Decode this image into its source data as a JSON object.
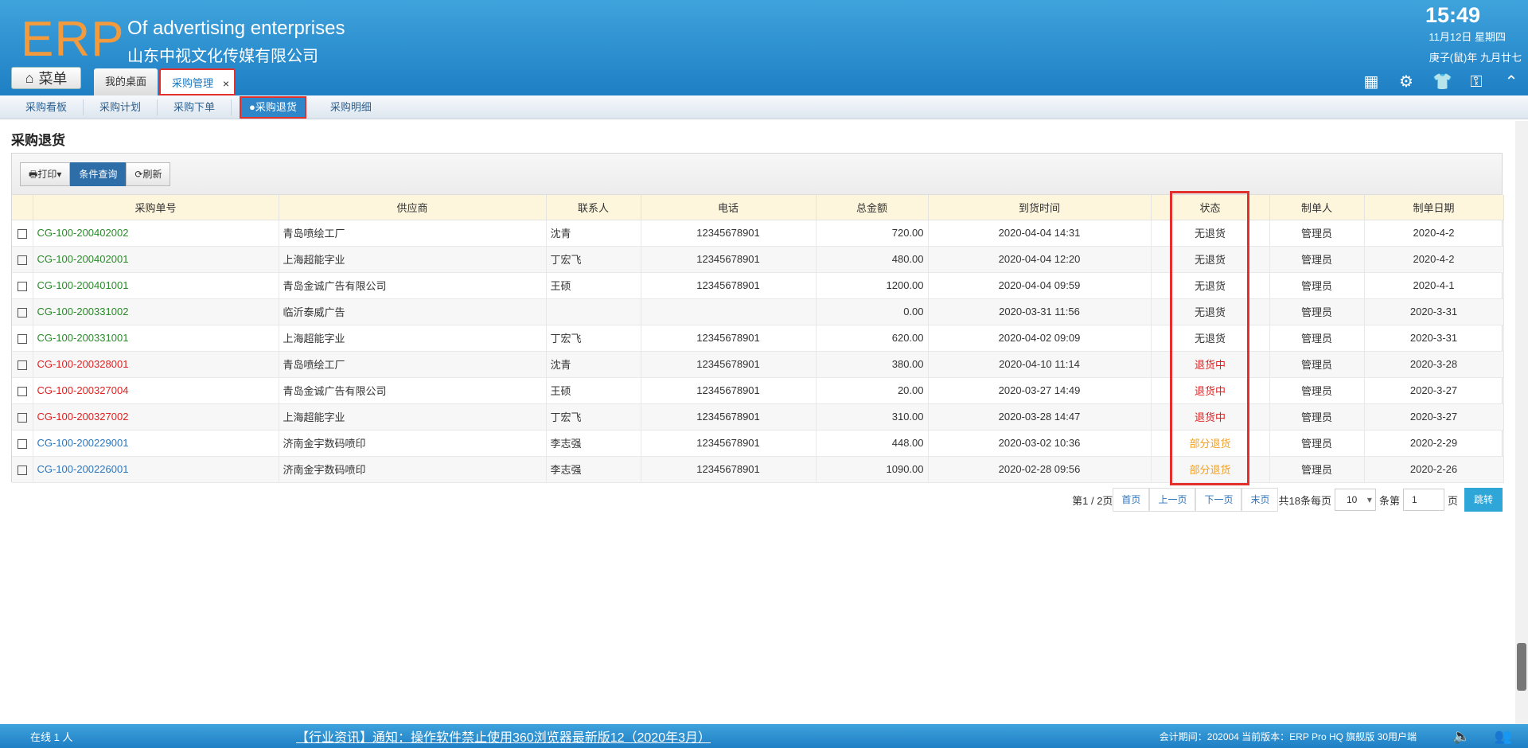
{
  "header": {
    "logo": "ERP",
    "company_en": "Of advertising enterprises",
    "company_cn": "山东中视文化传媒有限公司",
    "time": "15:49",
    "date": "11月12日 星期四",
    "lunar": "庚子(鼠)年 九月廿七",
    "menu_label": "菜单",
    "tabs": [
      {
        "label": "我的桌面"
      },
      {
        "label": "采购管理"
      }
    ],
    "close_glyph": "×",
    "icons": [
      "grid-add-icon",
      "gear-icon",
      "shirt-icon",
      "key-icon",
      "collapse-icon"
    ]
  },
  "subnav": {
    "items": [
      "采购看板",
      "采购计划",
      "采购下单",
      "●采购退货",
      "采购明细"
    ]
  },
  "page_title": "采购退货",
  "toolbar": {
    "print_label": "打印▾",
    "query_label": "条件查询",
    "refresh_label": "刷新"
  },
  "table": {
    "headers": [
      "采购单号",
      "供应商",
      "联系人",
      "电话",
      "总金额",
      "到货时间",
      "状态",
      "制单人",
      "制单日期"
    ],
    "rows": [
      {
        "no": "CG-100-200402002",
        "supplier": "青岛喷绘工厂",
        "contact": "沈青",
        "phone": "12345678901",
        "amount": "720.00",
        "arrival": "2020-04-04 14:31",
        "status": "无退货",
        "creator": "管理员",
        "date": "2020-4-2",
        "no_color": "#2a8a2a",
        "status_color": "#333333"
      },
      {
        "no": "CG-100-200402001",
        "supplier": "上海超能字业",
        "contact": "丁宏飞",
        "phone": "12345678901",
        "amount": "480.00",
        "arrival": "2020-04-04 12:20",
        "status": "无退货",
        "creator": "管理员",
        "date": "2020-4-2",
        "no_color": "#2a8a2a",
        "status_color": "#333333"
      },
      {
        "no": "CG-100-200401001",
        "supplier": "青岛金诚广告有限公司",
        "contact": "王硕",
        "phone": "12345678901",
        "amount": "1200.00",
        "arrival": "2020-04-04 09:59",
        "status": "无退货",
        "creator": "管理员",
        "date": "2020-4-1",
        "no_color": "#2a8a2a",
        "status_color": "#333333"
      },
      {
        "no": "CG-100-200331002",
        "supplier": "临沂泰威广告",
        "contact": "",
        "phone": "",
        "amount": "0.00",
        "arrival": "2020-03-31 11:56",
        "status": "无退货",
        "creator": "管理员",
        "date": "2020-3-31",
        "no_color": "#2a8a2a",
        "status_color": "#333333"
      },
      {
        "no": "CG-100-200331001",
        "supplier": "上海超能字业",
        "contact": "丁宏飞",
        "phone": "12345678901",
        "amount": "620.00",
        "arrival": "2020-04-02 09:09",
        "status": "无退货",
        "creator": "管理员",
        "date": "2020-3-31",
        "no_color": "#2a8a2a",
        "status_color": "#333333"
      },
      {
        "no": "CG-100-200328001",
        "supplier": "青岛喷绘工厂",
        "contact": "沈青",
        "phone": "12345678901",
        "amount": "380.00",
        "arrival": "2020-04-10 11:14",
        "status": "退货中",
        "creator": "管理员",
        "date": "2020-3-28",
        "no_color": "#e02020",
        "status_color": "#e02020"
      },
      {
        "no": "CG-100-200327004",
        "supplier": "青岛金诚广告有限公司",
        "contact": "王硕",
        "phone": "12345678901",
        "amount": "20.00",
        "arrival": "2020-03-27 14:49",
        "status": "退货中",
        "creator": "管理员",
        "date": "2020-3-27",
        "no_color": "#e02020",
        "status_color": "#e02020"
      },
      {
        "no": "CG-100-200327002",
        "supplier": "上海超能字业",
        "contact": "丁宏飞",
        "phone": "12345678901",
        "amount": "310.00",
        "arrival": "2020-03-28 14:47",
        "status": "退货中",
        "creator": "管理员",
        "date": "2020-3-27",
        "no_color": "#e02020",
        "status_color": "#e02020"
      },
      {
        "no": "CG-100-200229001",
        "supplier": "济南金宇数码喷印",
        "contact": "李志强",
        "phone": "12345678901",
        "amount": "448.00",
        "arrival": "2020-03-02 10:36",
        "status": "部分退货",
        "creator": "管理员",
        "date": "2020-2-29",
        "no_color": "#2b76be",
        "status_color": "#f0a020"
      },
      {
        "no": "CG-100-200226001",
        "supplier": "济南金宇数码喷印",
        "contact": "李志强",
        "phone": "12345678901",
        "amount": "1090.00",
        "arrival": "2020-02-28 09:56",
        "status": "部分退货",
        "creator": "管理员",
        "date": "2020-2-26",
        "no_color": "#2b76be",
        "status_color": "#f0a020"
      }
    ]
  },
  "pager": {
    "page_info": "第1 / 2页",
    "first": "首页",
    "prev": "上一页",
    "next": "下一页",
    "last": "末页",
    "total": "共18条每页",
    "per_page": "10",
    "per_page_suffix": "条第",
    "page_input": "1",
    "page_suffix": "页",
    "go": "跳转"
  },
  "footer": {
    "online": "在线  1  人",
    "news": "【行业资讯】通知：操作软件禁止使用360浏览器最新版12（2020年3月）",
    "version": "会计期间：202004 当前版本：ERP Pro HQ 旗舰版 30用户端"
  }
}
